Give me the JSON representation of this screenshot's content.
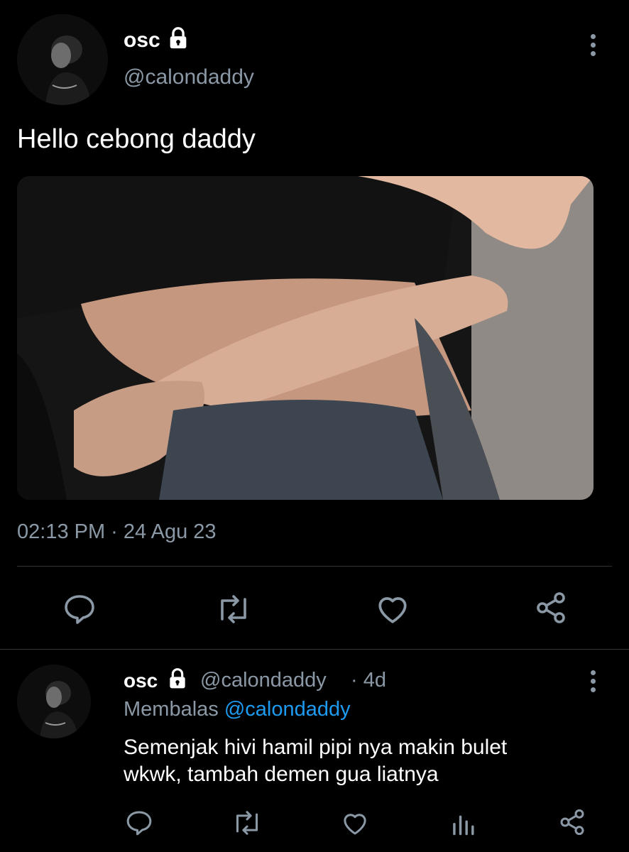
{
  "tweet": {
    "author_name": "osc",
    "author_handle": "@calondaddy",
    "text": "Hello cebong daddy",
    "timestamp": "02:13 PM · 24 Agu 23"
  },
  "reply": {
    "author_name": "osc",
    "author_handle": "@calondaddy",
    "age": "· 4d",
    "replying_to_label": "Membalas",
    "replying_to_handle": "@calondaddy",
    "text_line1": "Semenjak hivi hamil pipi nya makin bulet",
    "text_line2": "wkwk, tambah demen gua liatnya"
  },
  "icons": {
    "lock": "lock-icon",
    "more": "more-vertical-icon",
    "reply": "reply-icon",
    "retweet": "retweet-icon",
    "like": "heart-icon",
    "share": "share-icon",
    "analytics": "analytics-icon"
  },
  "colors": {
    "background": "#000000",
    "muted_text": "#8b98a5",
    "link": "#1d9bf0",
    "divider": "#2f3336"
  }
}
